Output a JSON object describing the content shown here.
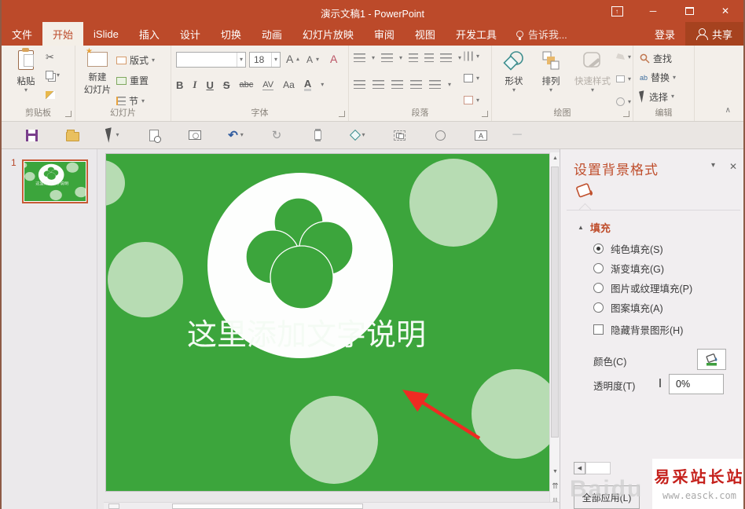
{
  "window": {
    "title": "演示文稿1 - PowerPoint"
  },
  "tabs": [
    "文件",
    "开始",
    "iSlide",
    "插入",
    "设计",
    "切换",
    "动画",
    "幻灯片放映",
    "审阅",
    "视图",
    "开发工具"
  ],
  "tellme": "告诉我...",
  "account": {
    "sign_in": "登录",
    "share": "共享"
  },
  "ribbon": {
    "clipboard": {
      "label": "剪贴板",
      "paste": "粘贴"
    },
    "slides": {
      "label": "幻灯片",
      "new_slide_1": "新建",
      "new_slide_2": "幻灯片",
      "layout": "版式",
      "reset": "重置",
      "section": "节"
    },
    "font": {
      "label": "字体",
      "size": "18",
      "bold": "B",
      "italic": "I",
      "underline": "U",
      "strike": "S",
      "abc": "abc",
      "av": "AV",
      "aa": "Aa",
      "grow": "A",
      "shrink": "A",
      "color": "A",
      "clear": "A"
    },
    "paragraph": {
      "label": "段落"
    },
    "drawing": {
      "label": "绘图",
      "shapes": "形状",
      "arrange": "排列",
      "quick_styles": "快速样式"
    },
    "editing": {
      "label": "编辑",
      "find": "查找",
      "replace": "替换",
      "select": "选择"
    }
  },
  "slide": {
    "number": "1",
    "caption": "这里添加文字说明"
  },
  "panel": {
    "title": "设置背景格式",
    "fill_section": "填充",
    "options": [
      "纯色填充(S)",
      "渐变填充(G)",
      "图片或纹理填充(P)",
      "图案填充(A)"
    ],
    "hide_bg": "隐藏背景图形(H)",
    "color_label": "颜色(C)",
    "transparency_label": "透明度(T)",
    "transparency_value": "0%",
    "apply_all": "全部应用(L)"
  },
  "watermark": {
    "brand": "易采站长站",
    "url": "www.easck.com",
    "baidu": "Baidu"
  },
  "icons": {
    "dropdown": "▾",
    "close": "✕",
    "minimize": "─",
    "collapse": "∧",
    "up": "▲",
    "down": "▼",
    "left": "◀",
    "prev_slide": "⇈",
    "next_slide": "⇊",
    "undo": "↶",
    "redo": "↻",
    "cut": "✂",
    "dash": "─",
    "ribbon_up": "↑",
    "find_glass": "⌕"
  },
  "colors": {
    "slide_green": "#3CA53C",
    "circle_light": "#B7DCB3",
    "arrow_red": "#EE2B22",
    "accent": "#BC4A2A"
  }
}
